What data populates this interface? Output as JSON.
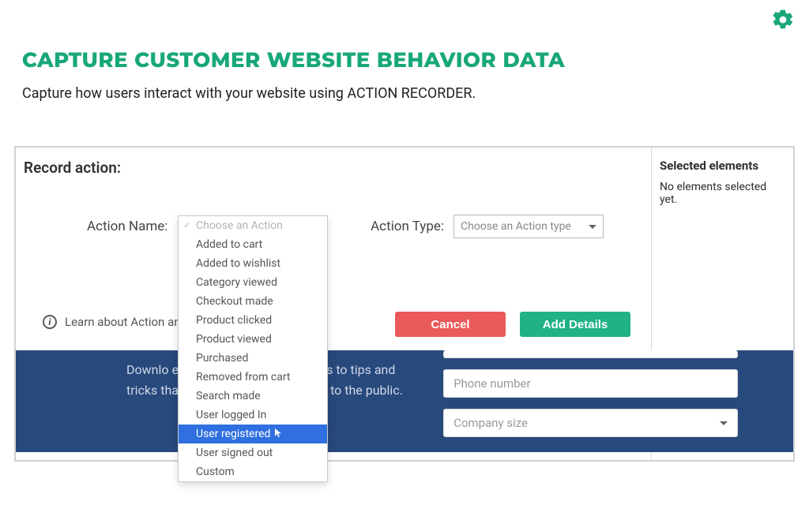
{
  "header": {
    "title": "CAPTURE CUSTOMER WEBSITE BEHAVIOR DATA",
    "subtitle": "Capture how users interact with your website using ACTION RECORDER."
  },
  "panel": {
    "record_label": "Record action:",
    "action_name_label": "Action Name:",
    "action_type_label": "Action Type:",
    "action_type_placeholder": "Choose an Action type",
    "learn_text": "Learn about Action and A",
    "cancel_btn": "Cancel",
    "add_details_btn": "Add Details"
  },
  "sidebar": {
    "heading": "Selected elements",
    "empty_text": "No elements selected yet."
  },
  "dropdown": {
    "placeholder": "Choose an Action",
    "items": [
      "Added to cart",
      "Added to wishlist",
      "Category viewed",
      "Checkout made",
      "Product clicked",
      "Product viewed",
      "Purchased",
      "Removed from cart",
      "Search made",
      "User logged In",
      "User registered",
      "User signed out",
      "Custom"
    ],
    "highlighted": "User registered"
  },
  "background_page": {
    "text_partial": "Downlo                                                en released this year by                                                cess to tips and tricks that have never been revealed to the public.",
    "phone_placeholder": "Phone number",
    "company_placeholder": "Company size"
  }
}
